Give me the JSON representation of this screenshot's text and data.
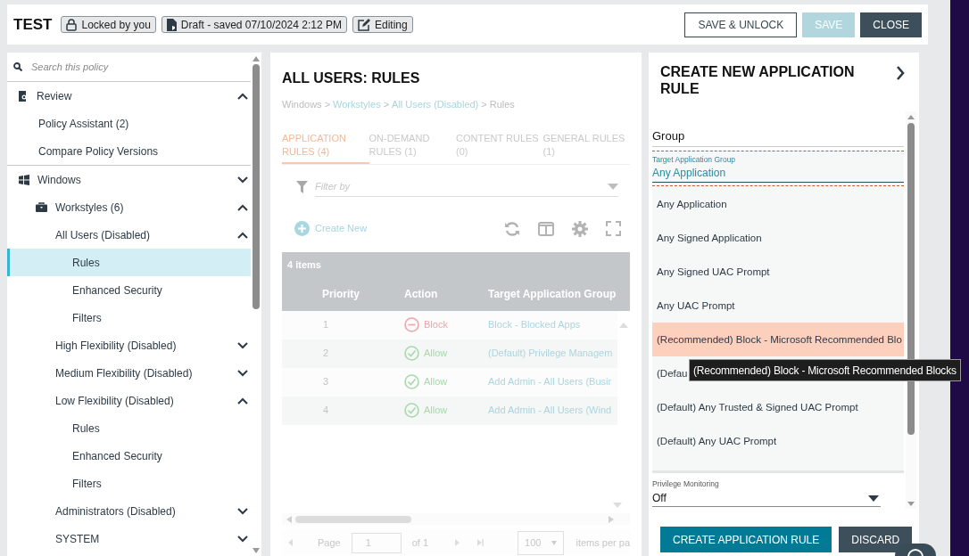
{
  "header": {
    "title": "TEST",
    "badges": [
      {
        "kind": "lock",
        "label": "Locked by you"
      },
      {
        "kind": "file",
        "label": "Draft - saved 07/10/2024 2:12 PM"
      },
      {
        "kind": "edit",
        "label": "Editing"
      }
    ],
    "buttons": [
      {
        "label": "SAVE & UNLOCK",
        "kind": "outline",
        "disabled": false
      },
      {
        "label": "SAVE",
        "kind": "primary",
        "disabled": true
      },
      {
        "label": "CLOSE",
        "kind": "dark",
        "disabled": false
      }
    ]
  },
  "sidebar": {
    "search": {
      "placeholder": "Search this policy"
    },
    "sections": [
      {
        "items": [
          {
            "label": "Review",
            "kind": "review",
            "expanded": true,
            "selected": false,
            "children": [
              {
                "label": "Policy Assistant (2)",
                "selected": false
              },
              {
                "label": "Compare Policy Versions",
                "selected": false
              }
            ]
          }
        ]
      },
      {
        "items": [
          {
            "label": "Windows",
            "kind": "windows",
            "expanded": false,
            "selected": false,
            "children": [
              {
                "label": "Workstyles (6)",
                "kind": "briefcase",
                "expanded": true,
                "selected": false,
                "children": [
                  {
                    "label": "All Users (Disabled)",
                    "expanded": true,
                    "selected": false,
                    "children": [
                      {
                        "label": "Rules",
                        "selected": true
                      },
                      {
                        "label": "Enhanced Security",
                        "selected": false
                      },
                      {
                        "label": "Filters",
                        "selected": false
                      }
                    ]
                  },
                  {
                    "label": "High Flexibility (Disabled)",
                    "expanded": false,
                    "selected": false
                  },
                  {
                    "label": "Medium Flexibility (Disabled)",
                    "expanded": false,
                    "selected": false
                  },
                  {
                    "label": "Low Flexibility (Disabled)",
                    "expanded": true,
                    "selected": false,
                    "children": [
                      {
                        "label": "Rules",
                        "selected": false
                      },
                      {
                        "label": "Enhanced Security",
                        "selected": false
                      },
                      {
                        "label": "Filters",
                        "selected": false
                      }
                    ]
                  },
                  {
                    "label": "Administrators (Disabled)",
                    "expanded": false,
                    "selected": false
                  },
                  {
                    "label": "SYSTEM",
                    "expanded": false,
                    "selected": false
                  }
                ]
              }
            ]
          }
        ]
      }
    ]
  },
  "main": {
    "title": "ALL USERS: RULES",
    "breadcrumb": {
      "separator": ">",
      "items": [
        {
          "label": "Windows",
          "link": false
        },
        {
          "label": "Workstyles",
          "link": true
        },
        {
          "label": "All Users (Disabled)",
          "link": true
        },
        {
          "label": "Rules",
          "link": false
        }
      ]
    },
    "tabs": [
      {
        "label": "APPLICATION RULES (4)",
        "selected": true
      },
      {
        "label": "ON-DEMAND RULES (1)",
        "selected": false
      },
      {
        "label": "CONTENT RULES (0)",
        "selected": false
      },
      {
        "label": "GENERAL RULES (1)",
        "selected": false
      }
    ],
    "filter": {
      "placeholder": "Filter by"
    },
    "create_new": "Create New",
    "table": {
      "count": "4 items",
      "columns": [
        "Priority",
        "Action",
        "Target Application Group"
      ],
      "rows": [
        {
          "priority": "1",
          "action": "Block",
          "kind": "block",
          "group": "Block - Blocked Apps"
        },
        {
          "priority": "2",
          "action": "Allow",
          "kind": "allow",
          "group": "(Default) Privilege Managem"
        },
        {
          "priority": "3",
          "action": "Allow",
          "kind": "allow",
          "group": "Add Admin - All Users (Busir"
        },
        {
          "priority": "4",
          "action": "Allow",
          "kind": "allow",
          "group": "Add Admin - All Users (Wind"
        }
      ]
    },
    "pagination": {
      "page_label": "Page",
      "page": "1",
      "of": "of 1",
      "per_page": "100",
      "per_page_label": "items per pa"
    }
  },
  "panel": {
    "title": "CREATE NEW APPLICATION RULE",
    "section": "Group",
    "field": {
      "label": "Target Application Group",
      "value": "Any Application"
    },
    "options": [
      {
        "label": "Any Application",
        "selected": false
      },
      {
        "label": "Any Signed Application",
        "selected": false
      },
      {
        "label": "Any Signed UAC Prompt",
        "selected": false
      },
      {
        "label": "Any UAC Prompt",
        "selected": false
      },
      {
        "label": "(Recommended) Block - Microsoft Recommended Blo",
        "selected": true
      },
      {
        "label": "(Defau",
        "selected": false
      },
      {
        "label": "(Default) Any Trusted & Signed UAC Prompt",
        "selected": false
      },
      {
        "label": "(Default) Any UAC Prompt",
        "selected": false
      }
    ],
    "tooltip": "(Recommended) Block - Microsoft Recommended Blocks",
    "monitoring": {
      "label": "Privilege Monitoring",
      "value": "Off"
    },
    "buttons": [
      {
        "label": "CREATE APPLICATION RULE",
        "kind": "primary"
      },
      {
        "label": "DISCARD",
        "kind": "dark"
      }
    ]
  }
}
